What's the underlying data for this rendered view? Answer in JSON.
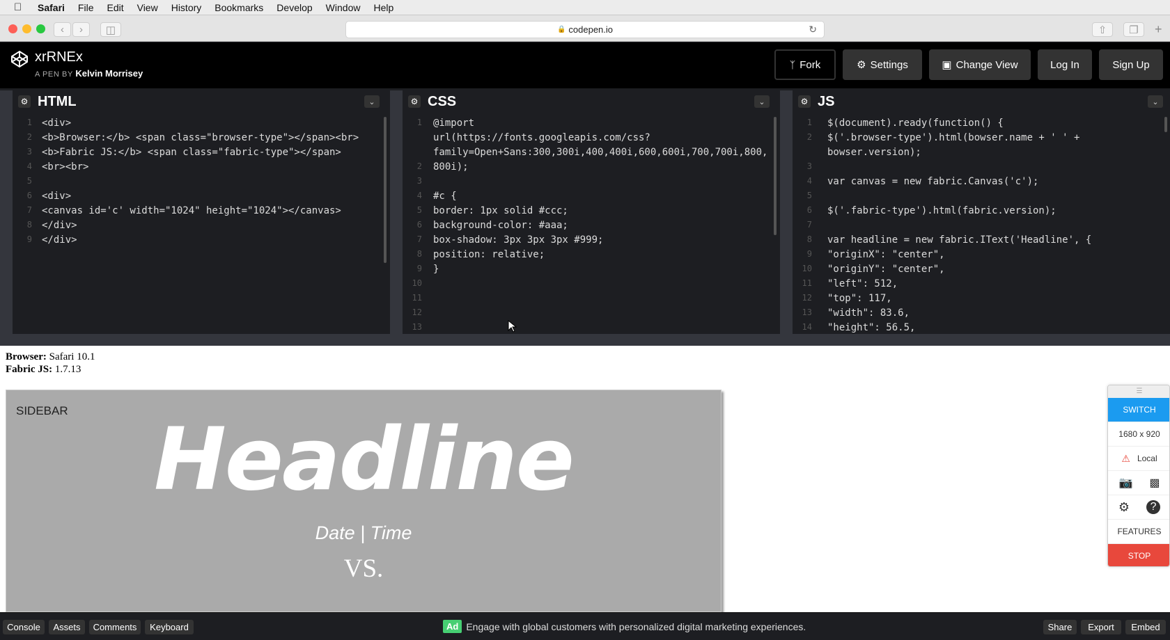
{
  "menubar": {
    "apple": "",
    "items": [
      "Safari",
      "File",
      "Edit",
      "View",
      "History",
      "Bookmarks",
      "Develop",
      "Window",
      "Help"
    ]
  },
  "browser": {
    "url": "codepen.io"
  },
  "header": {
    "pen_title": "xrRNEx",
    "pen_by_prefix": "A PEN BY",
    "author": "Kelvin Morrisey",
    "buttons": {
      "fork": "Fork",
      "settings": "Settings",
      "change_view": "Change View",
      "login": "Log In",
      "signup": "Sign Up"
    }
  },
  "editors": {
    "html": {
      "title": "HTML",
      "lines": [
        {
          "n": "1",
          "t": "<div>"
        },
        {
          "n": "2",
          "t": "  <b>Browser:</b> <span class=\"browser-type\"></span><br>"
        },
        {
          "n": "3",
          "t": "  <b>Fabric JS:</b> <span class=\"fabric-type\"></span>"
        },
        {
          "n": "4",
          "t": "  <br><br>"
        },
        {
          "n": "5",
          "t": ""
        },
        {
          "n": "6",
          "t": "  <div>"
        },
        {
          "n": "7",
          "t": "    <canvas id='c' width=\"1024\" height=\"1024\"></canvas>"
        },
        {
          "n": "8",
          "t": "  </div>"
        },
        {
          "n": "9",
          "t": "</div>"
        }
      ]
    },
    "css": {
      "title": "CSS",
      "lines": [
        {
          "n": "1",
          "t": "@import"
        },
        {
          "n": "",
          "t": "url(https://fonts.googleapis.com/css?"
        },
        {
          "n": "",
          "t": "family=Open+Sans:300,300i,400,400i,600,600i,700,700i,800,"
        },
        {
          "n": "2",
          "t": "800i);"
        },
        {
          "n": "3",
          "t": ""
        },
        {
          "n": "4",
          "t": "#c {"
        },
        {
          "n": "5",
          "t": "  border: 1px solid #ccc;"
        },
        {
          "n": "6",
          "t": "  background-color: #aaa;"
        },
        {
          "n": "7",
          "t": "  box-shadow: 3px 3px 3px #999;"
        },
        {
          "n": "8",
          "t": "  position: relative;"
        },
        {
          "n": "9",
          "t": "}"
        },
        {
          "n": "10",
          "t": ""
        },
        {
          "n": "11",
          "t": ""
        },
        {
          "n": "12",
          "t": ""
        },
        {
          "n": "13",
          "t": ""
        }
      ]
    },
    "js": {
      "title": "JS",
      "lines": [
        {
          "n": "1",
          "t": "$(document).ready(function() {"
        },
        {
          "n": "2",
          "t": "    $('.browser-type').html(bowser.name + ' ' +"
        },
        {
          "n": "",
          "t": "bowser.version);"
        },
        {
          "n": "3",
          "t": ""
        },
        {
          "n": "4",
          "t": "    var canvas = new fabric.Canvas('c');"
        },
        {
          "n": "5",
          "t": ""
        },
        {
          "n": "6",
          "t": "    $('.fabric-type').html(fabric.version);"
        },
        {
          "n": "7",
          "t": ""
        },
        {
          "n": "8",
          "t": "    var headline = new fabric.IText('Headline', {"
        },
        {
          "n": "9",
          "t": "      \"originX\": \"center\","
        },
        {
          "n": "10",
          "t": "      \"originY\": \"center\","
        },
        {
          "n": "11",
          "t": "      \"left\": 512,"
        },
        {
          "n": "12",
          "t": "      \"top\": 117,"
        },
        {
          "n": "13",
          "t": "      \"width\": 83.6,"
        },
        {
          "n": "14",
          "t": "      \"height\": 56.5,"
        }
      ]
    }
  },
  "preview": {
    "browser_label": "Browser:",
    "browser_value": "Safari 10.1",
    "fabric_label": "Fabric JS:",
    "fabric_value": "1.7.13",
    "canvas": {
      "sidebar": "SIDEBAR",
      "headline": "Headline",
      "datetime": "Date | Time",
      "vs": "VS."
    }
  },
  "widget": {
    "switch": "SWITCH",
    "size": "1680 x 920",
    "local": "Local",
    "features": "FEATURES",
    "stop": "STOP"
  },
  "footer": {
    "console": "Console",
    "assets": "Assets",
    "comments": "Comments",
    "keyboard": "Keyboard",
    "ad_badge": "Ad",
    "ad_text": "Engage with global customers with personalized digital marketing experiences.",
    "share": "Share",
    "export": "Export",
    "embed": "Embed"
  },
  "colors": {
    "accent_green": "#47cf73",
    "switch_blue": "#1b9bf0",
    "stop_red": "#e8483c"
  }
}
